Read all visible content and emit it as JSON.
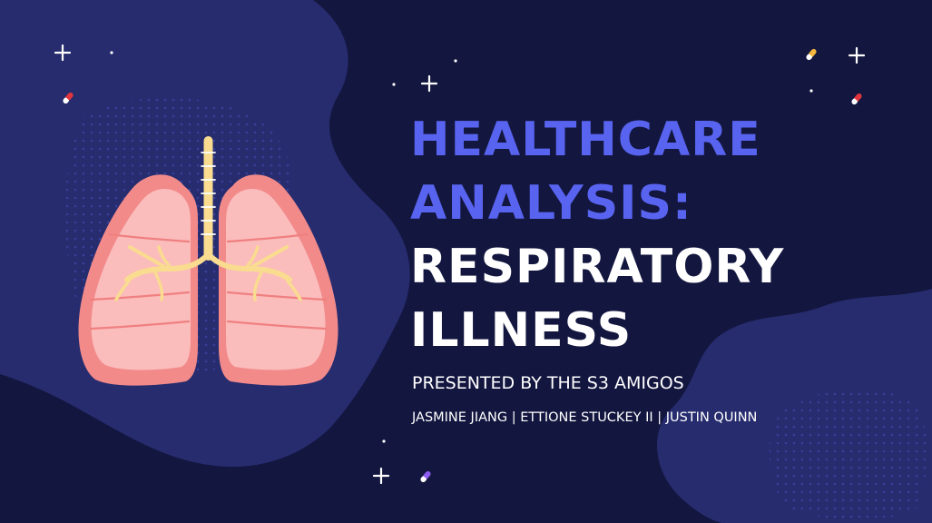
{
  "colors": {
    "background": "#13163f",
    "blob": "#262c6e",
    "accent_blue": "#5864f0",
    "title_white": "#ffffff",
    "lung_outer": "#f28a8a",
    "lung_inner": "#fbbcbc",
    "trachea": "#f9dc8f"
  },
  "title": {
    "line1": "HEALTHCARE",
    "line2": "ANALYSIS:",
    "line3": "RESPIRATORY",
    "line4": "ILLNESS"
  },
  "subtitle": "PRESENTED BY THE S3 AMIGOS",
  "authors": "JASMINE JIANG | ETTIONE STUCKEY II | JUSTIN QUINN",
  "icons": [
    "lungs-illustration",
    "sparkle-icon",
    "pill-icon",
    "dot-pattern"
  ]
}
